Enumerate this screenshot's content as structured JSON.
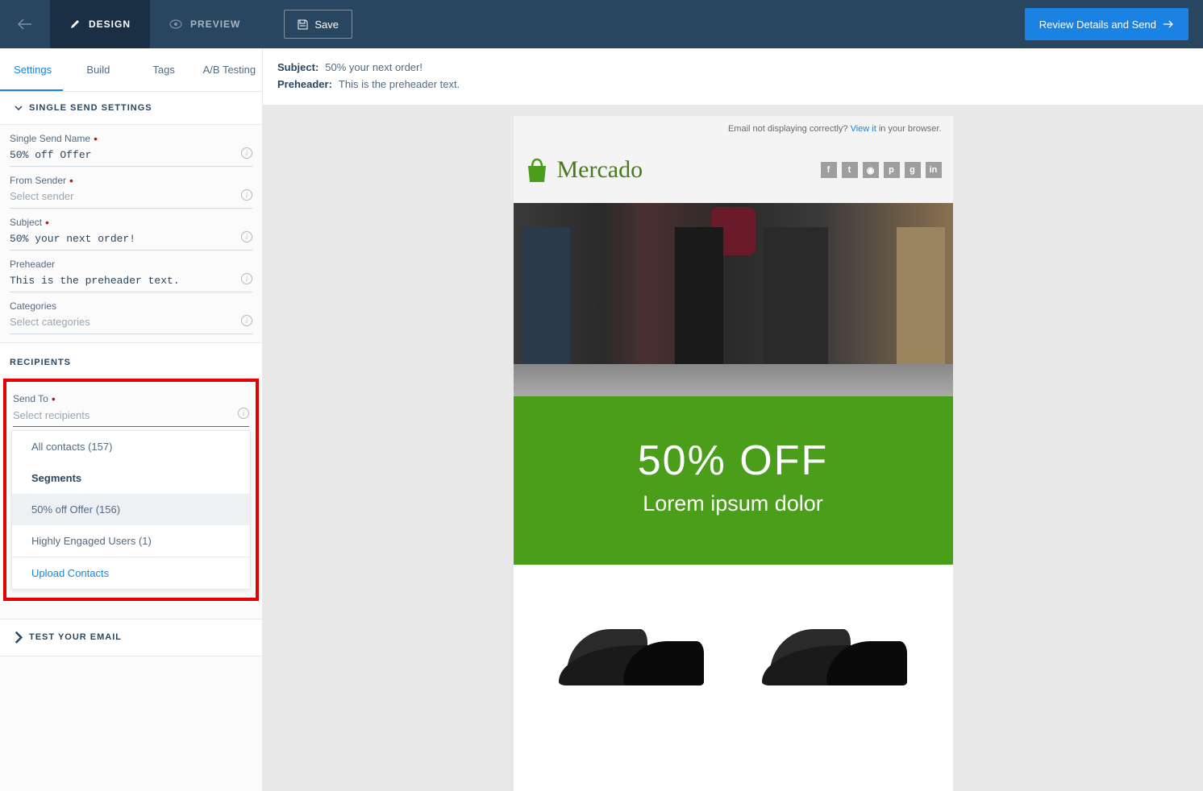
{
  "header": {
    "design_label": "DESIGN",
    "preview_label": "PREVIEW",
    "save_label": "Save",
    "review_label": "Review Details and Send"
  },
  "subtabs": {
    "settings": "Settings",
    "build": "Build",
    "tags": "Tags",
    "ab": "A/B Testing"
  },
  "sections": {
    "single_send_settings": "SINGLE SEND SETTINGS",
    "recipients": "RECIPIENTS",
    "test_email": "TEST YOUR EMAIL"
  },
  "fields": {
    "name_label": "Single Send Name",
    "name_value": "50% off Offer",
    "sender_label": "From Sender",
    "sender_placeholder": "Select sender",
    "subject_label": "Subject",
    "subject_value": "50% your next order!",
    "preheader_label": "Preheader",
    "preheader_value": "This is the preheader text.",
    "categories_label": "Categories",
    "categories_placeholder": "Select categories",
    "sendto_label": "Send To",
    "sendto_placeholder": "Select recipients"
  },
  "dropdown": {
    "all_contacts": "All contacts (157)",
    "segments_header": "Segments",
    "opt1": "50% off Offer (156)",
    "opt2": "Highly Engaged Users (1)",
    "upload": "Upload Contacts"
  },
  "preview": {
    "subject_label": "Subject:",
    "subject_value": "50% your next order!",
    "preheader_label": "Preheader:",
    "preheader_value": "This is the preheader text."
  },
  "email": {
    "not_displaying": "Email not displaying correctly? ",
    "view_it": "View it",
    "in_browser": " in your browser.",
    "brand": "Mercado",
    "offer_title": "50% OFF",
    "offer_sub": "Lorem ipsum dolor"
  }
}
